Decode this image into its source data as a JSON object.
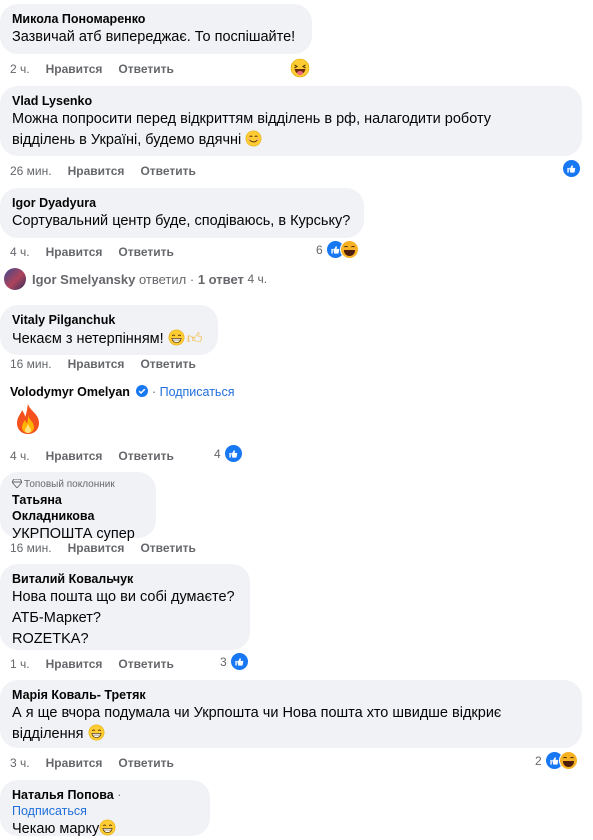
{
  "comments": [
    {
      "author": "Микола Пономаренко",
      "text": "Зазвичай атб випереджає. То поспішайте!",
      "time": "2 ч."
    },
    {
      "author": "Vlad Lysenko",
      "text_line1": "Можна попросити перед відкриттям відділень в рф, налагодити роботу",
      "text_line2": "відділень в Україні, будемо вдячні",
      "time": "26 мин."
    },
    {
      "author": "Igor Dyadyura",
      "text": "Сортувальний центр буде, сподіваюсь, в Курську?",
      "time": "4 ч.",
      "reaction_count": "6"
    },
    {
      "author": "Vitaly Pilganchuk",
      "text": "Чекаєм з нетерпінням!",
      "time": "16 мин."
    },
    {
      "author": "Volodymyr Omelyan",
      "subscribe": "Подписаться",
      "time": "4 ч.",
      "reaction_count": "4"
    },
    {
      "badge": "Топовый поклонник",
      "author": "Татьяна Окладникова",
      "text": "УКРПОШТА супер",
      "time": "16 мин."
    },
    {
      "author": "Виталий Ковальчук",
      "text_line1": "Нова пошта що ви собі думаєте?",
      "text_line2": "АТБ-Маркет?",
      "text_line3": "ROZETKA?",
      "time": "1 ч.",
      "reaction_count": "3"
    },
    {
      "author": "Марія Коваль- Третяк",
      "text_line1": "А я ще вчора подумала чи Укрпошта чи Нова пошта хто швидше відкриє",
      "text_line2": "відділення",
      "time": "3 ч.",
      "reaction_count": "2"
    },
    {
      "author": "Наталья Попова",
      "subscribe": "Подписаться",
      "text": "Чекаю марку"
    }
  ],
  "reply_summary": {
    "name": "Igor Smelyansky",
    "action": "ответил",
    "count": "1 ответ",
    "time": "4 ч."
  },
  "labels": {
    "like": "Нравится",
    "reply": "Ответить",
    "dot": "·"
  },
  "colors": {
    "bubble": "#f0f2f5",
    "link": "#216fdb",
    "like_blue": "#1877f2",
    "meta_gray": "#65676b"
  }
}
